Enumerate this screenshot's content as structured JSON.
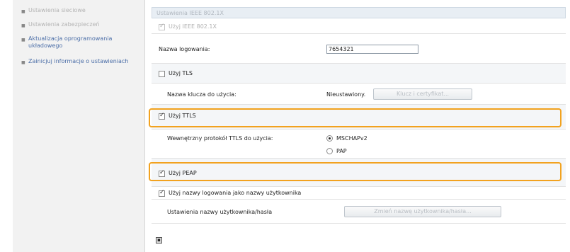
{
  "sidebar": {
    "items": [
      {
        "label": "Ustawienia sieciowe"
      },
      {
        "label": "Ustawienia zabezpieczeń"
      },
      {
        "label": "Aktualizacja oprogramowania układowego"
      },
      {
        "label": "Zainicjuj informacje o ustawieniach"
      }
    ]
  },
  "main": {
    "section_title": "Ustawienia IEEE 802.1X",
    "use_ieee": {
      "label": "Użyj IEEE 802.1X",
      "checked": true
    },
    "login_name": {
      "label": "Nazwa logowania:",
      "value": "7654321"
    },
    "use_tls": {
      "label": "Użyj TLS",
      "checked": false
    },
    "key_name": {
      "label": "Nazwa klucza do użycia:",
      "value": "Nieustawiony.",
      "button": "Klucz i certyfikat..."
    },
    "use_ttls": {
      "label": "Użyj TTLS",
      "checked": true
    },
    "ttls_protocol": {
      "label": "Wewnętrzny protokół TTLS do użycia:",
      "options": [
        "MSCHAPv2",
        "PAP"
      ],
      "selected": "MSCHAPv2"
    },
    "use_peap": {
      "label": "Użyj PEAP",
      "checked": true
    },
    "use_login_as_user": {
      "label": "Użyj nazwy logowania jako nazwy użytkownika",
      "checked": true
    },
    "user_settings": {
      "label": "Ustawienia nazwy użytkownika/hasła",
      "button": "Zmień nazwę użytkownika/hasła..."
    }
  },
  "colors": {
    "highlight": "#f2a21f",
    "sidebar_bg": "#f2f2f2",
    "header_bg": "#e8eef4"
  },
  "footer": {
    "icon": "collapse-icon"
  }
}
